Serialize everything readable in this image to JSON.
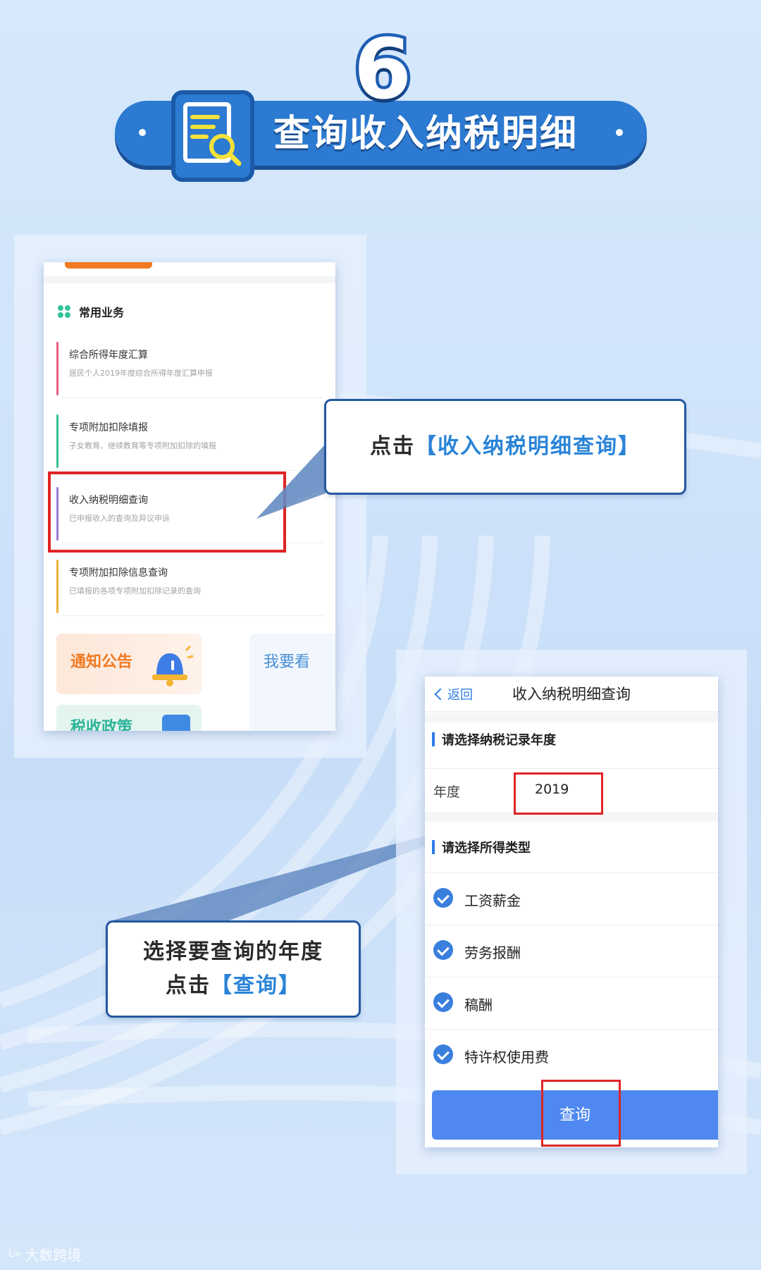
{
  "header": {
    "step_number": "6",
    "title": "查询收入纳税明细",
    "icon": "document-search-icon"
  },
  "left_screen": {
    "section_title": "常用业务",
    "section_icon": "clover-icon",
    "items": [
      {
        "name": "综合所得年度汇算",
        "desc": "居民个人2019年度综合所得年度汇算申报",
        "color": "#e8607e"
      },
      {
        "name": "专项附加扣除填报",
        "desc": "子女教育、继续教育等专项附加扣除的填报",
        "color": "#35c28f"
      },
      {
        "name": "收入纳税明细查询",
        "desc": "已申报收入的查询及异议申诉",
        "color": "#9b78d6"
      },
      {
        "name": "专项附加扣除信息查询",
        "desc": "已填报的各项专项附加扣除记录的查询",
        "color": "#f0b13a"
      }
    ],
    "cards": {
      "notice": "通知公告",
      "help": "我要看",
      "policy": "税收政策"
    }
  },
  "callouts": {
    "first": {
      "prefix": "点击",
      "open": "【",
      "highlight": "收入纳税明细查询",
      "close": "】"
    },
    "second": {
      "line1": "选择要查询的年度",
      "prefix": "点击",
      "open": "【",
      "highlight": "查询",
      "close": "】"
    }
  },
  "right_screen": {
    "back_label": "返回",
    "title": "收入纳税明细查询",
    "year_section": "请选择纳税记录年度",
    "year_label": "年度",
    "year_value": "2019",
    "type_section": "请选择所得类型",
    "types": [
      "工资薪金",
      "劳务报酬",
      "稿酬",
      "特许权使用费"
    ],
    "query_button": "查询"
  },
  "watermark": {
    "logo": "ᒪ∞",
    "text": "大数跨境"
  },
  "colors": {
    "brand_blue": "#2c7ad1",
    "highlight_red": "#e02424",
    "accent_blue": "#2a84d8",
    "button_blue": "#4f88f0",
    "orange": "#f07a22"
  }
}
